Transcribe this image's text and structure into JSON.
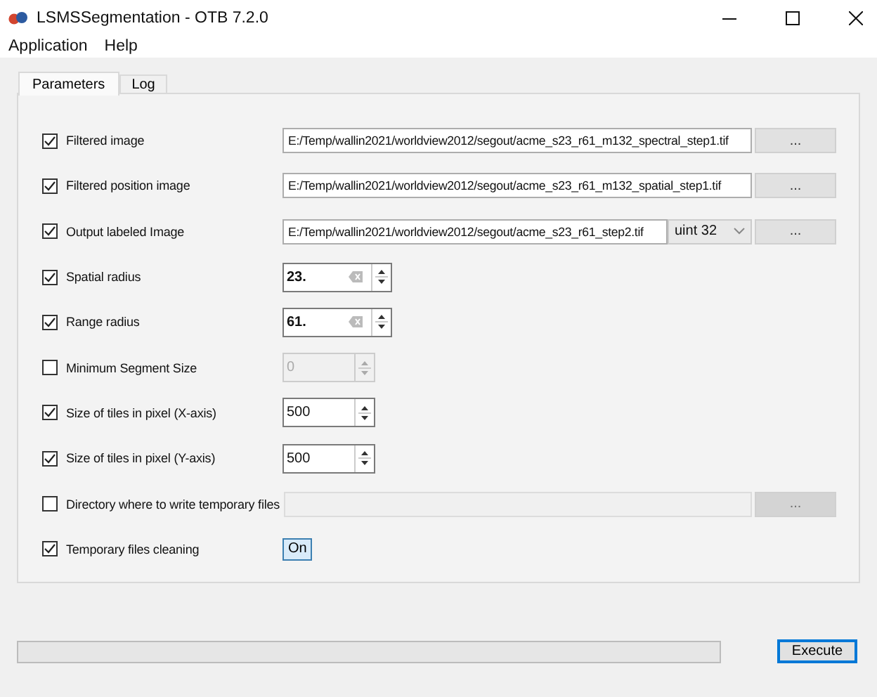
{
  "window": {
    "title": "LSMSSegmentation - OTB 7.2.0"
  },
  "menu": [
    "Application",
    "Help"
  ],
  "tabs": [
    {
      "label": "Parameters",
      "selected": true
    },
    {
      "label": "Log",
      "selected": false
    }
  ],
  "rows": [
    {
      "kind": "file",
      "label": "Filtered image",
      "checked": true,
      "disabled": false,
      "value": "E:/Temp/wallin2021/worldview2012/segout/acme_s23_r61_m132_spectral_step1.tif",
      "browse": "..."
    },
    {
      "kind": "file",
      "label": "Filtered position image",
      "checked": true,
      "disabled": false,
      "value": "E:/Temp/wallin2021/worldview2012/segout/acme_s23_r61_m132_spatial_step1.tif",
      "browse": "..."
    },
    {
      "kind": "output",
      "label": "Output labeled Image",
      "checked": true,
      "disabled": false,
      "value": "E:/Temp/wallin2021/worldview2012/segout/acme_s23_r61_step2.tif",
      "pixel_type": "uint 32",
      "browse": "..."
    },
    {
      "kind": "float",
      "label": "Spatial radius",
      "checked": true,
      "disabled": false,
      "value": "23."
    },
    {
      "kind": "float",
      "label": "Range radius",
      "checked": true,
      "disabled": false,
      "value": "61."
    },
    {
      "kind": "int",
      "label": "Minimum Segment Size",
      "checked": false,
      "disabled": true,
      "value": "0"
    },
    {
      "kind": "int",
      "label": "Size of tiles in pixel (X-axis)",
      "checked": true,
      "disabled": false,
      "value": "500"
    },
    {
      "kind": "int",
      "label": "Size of tiles in pixel (Y-axis)",
      "checked": true,
      "disabled": false,
      "value": "500"
    },
    {
      "kind": "dir",
      "label": "Directory where to write temporary files",
      "checked": false,
      "disabled": true,
      "browse": "..."
    },
    {
      "kind": "toggle",
      "label": "Temporary files cleaning",
      "checked": true,
      "disabled": false,
      "value": "On"
    }
  ],
  "progress": {
    "level": 0
  },
  "execute": "Execute"
}
